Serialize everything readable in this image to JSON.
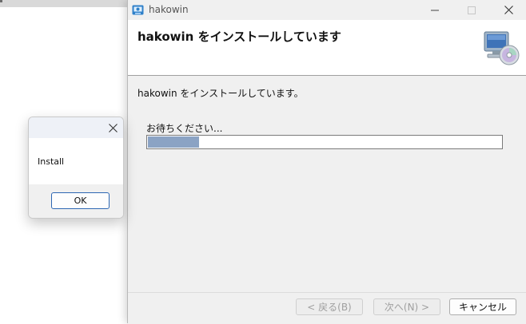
{
  "installer": {
    "window_title": "hakowin",
    "header_title": "hakowin をインストールしています",
    "body_text": "hakowin をインストールしています。",
    "wait_label": "お待ちください...",
    "progress_fraction": 0.145,
    "buttons": {
      "back": "< 戻る(B)",
      "next": "次へ(N) >",
      "cancel": "キャンセル"
    },
    "icons": [
      "app-installer-icon",
      "computer-cd-icon",
      "minimize-icon",
      "maximize-icon",
      "close-icon"
    ]
  },
  "message_box": {
    "text": "Install",
    "ok_label": "OK",
    "icons": [
      "close-icon"
    ]
  }
}
